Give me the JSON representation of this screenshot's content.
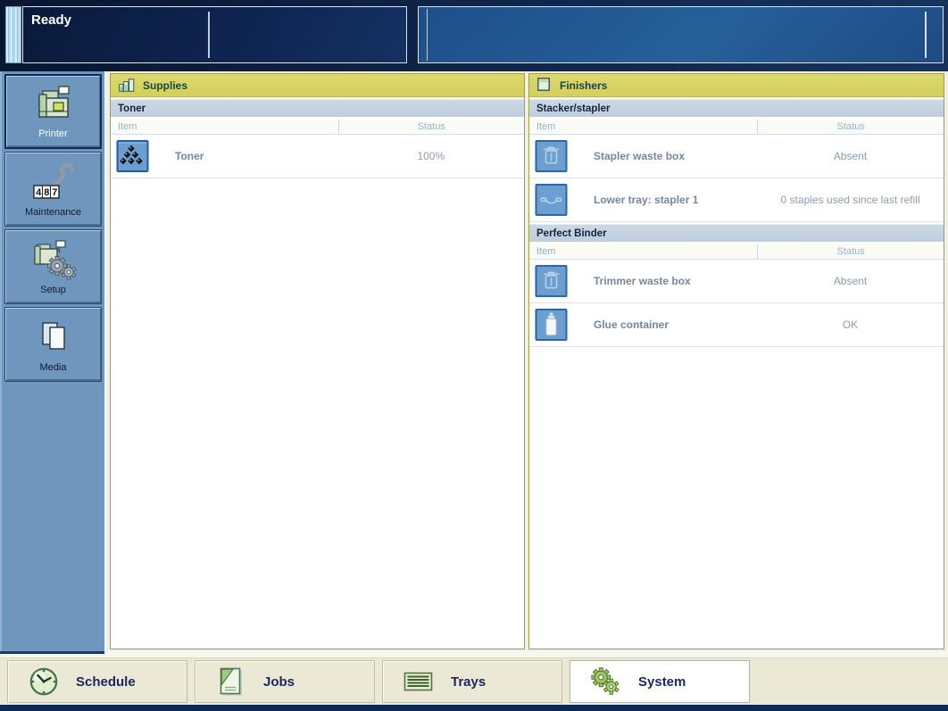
{
  "top_bar": {
    "status_text": "Ready"
  },
  "sidebar": {
    "items": [
      {
        "label": "Printer",
        "icon": "printer-icon",
        "selected": true
      },
      {
        "label": "Maintenance",
        "icon": "maintenance-icon",
        "selected": false
      },
      {
        "label": "Setup",
        "icon": "setup-icon",
        "selected": false
      },
      {
        "label": "Media",
        "icon": "media-icon",
        "selected": false
      }
    ]
  },
  "panels": [
    {
      "id": "supplies",
      "title": "Supplies",
      "icon": "supplies-icon",
      "sections": [
        {
          "title": "Toner",
          "columns": [
            "Item",
            "Status"
          ],
          "rows": [
            {
              "icon": "toner-icon",
              "label": "Toner",
              "status": "100%"
            }
          ]
        }
      ]
    },
    {
      "id": "finishers",
      "title": "Finishers",
      "icon": "finishers-icon",
      "sections": [
        {
          "title": "Stacker/stapler",
          "columns": [
            "Item",
            "Status"
          ],
          "rows": [
            {
              "icon": "waste-box-icon",
              "label": "Stapler waste box",
              "status": "Absent"
            },
            {
              "icon": "stapler-icon",
              "label": "Lower tray: stapler 1",
              "status": "0 staples used since last refill"
            }
          ]
        },
        {
          "title": "Perfect Binder",
          "columns": [
            "Item",
            "Status"
          ],
          "rows": [
            {
              "icon": "waste-box-icon",
              "label": "Trimmer waste box",
              "status": "Absent"
            },
            {
              "icon": "glue-icon",
              "label": "Glue container",
              "status": "OK"
            }
          ]
        }
      ]
    }
  ],
  "bottom_tabs": [
    {
      "label": "Schedule",
      "icon": "clock-icon",
      "selected": false
    },
    {
      "label": "Jobs",
      "icon": "jobs-icon",
      "selected": false
    },
    {
      "label": "Trays",
      "icon": "trays-icon",
      "selected": false
    },
    {
      "label": "System",
      "icon": "gears-icon",
      "selected": true
    }
  ],
  "colors": {
    "panel_header_bg": "#d9d566",
    "panel_border": "#9f9f4b",
    "section_bar_bg": "#c6d3e1",
    "sidebar_bg": "#6f96bc",
    "icon_tile_fill": "#6c9ecf",
    "icon_tile_border": "#1e5fa2",
    "status_bar_navy": "#0c2a57",
    "selected_tab_bg": "#ffffff",
    "bottom_bar_bg": "#ebe8d5"
  }
}
